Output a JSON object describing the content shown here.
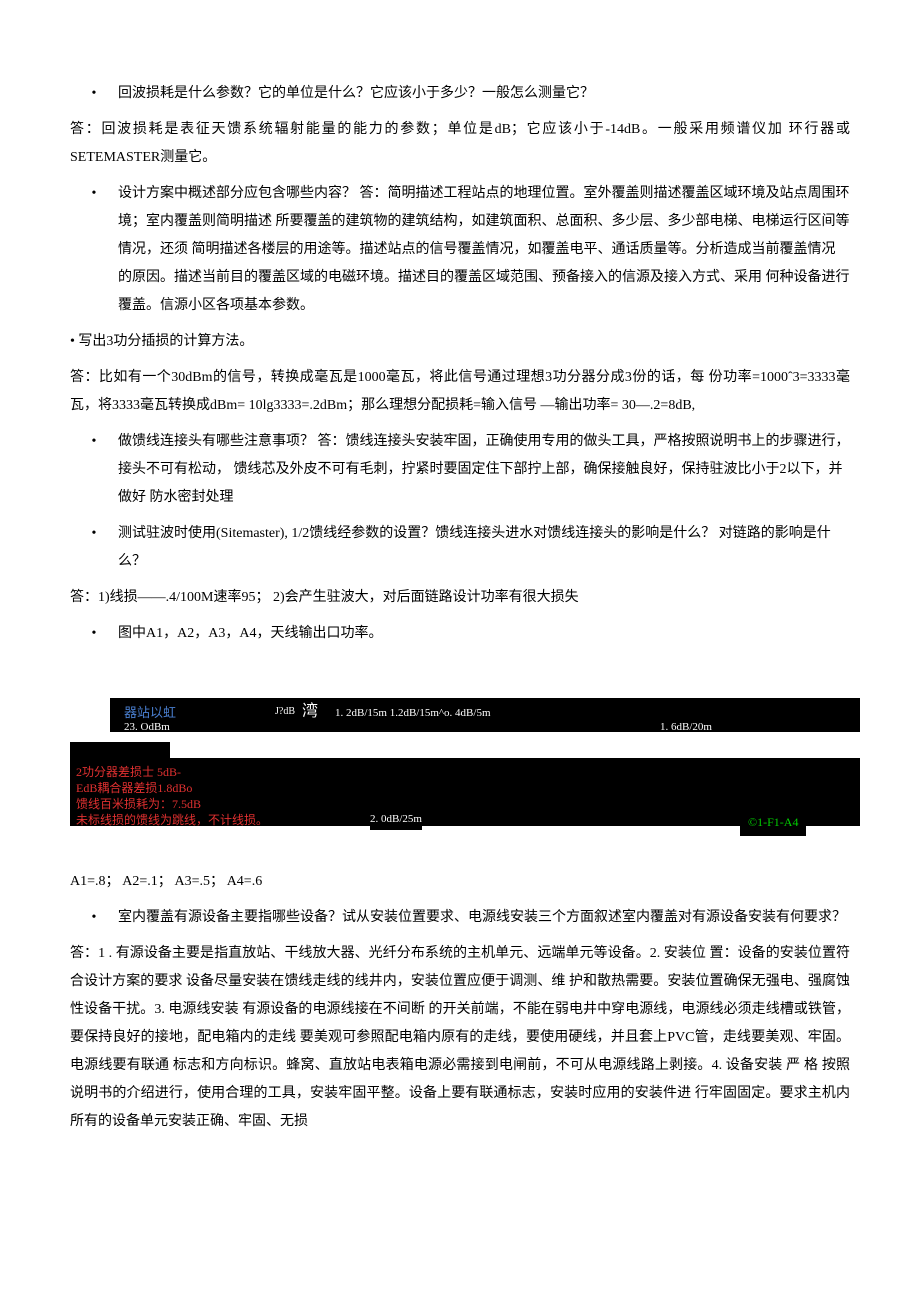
{
  "q1": {
    "question": "回波损耗是什么参数？它的单位是什么？它应该小于多少？一般怎么测量它？",
    "answer": "答：回波损耗是表征天馈系统辐射能量的能力的参数；单位是dB；它应该小于-14dB。一般采用频谱仪加 环行器或SETEMASTER测量它。"
  },
  "q2": {
    "question": "设计方案中概述部分应包含哪些内容？   答：简明描述工程站点的地理位置。室外覆盖则描述覆盖区域环境及站点周围环境；室内覆盖则简明描述  所要覆盖的建筑物的建筑结构，如建筑面积、总面积、多少层、多少部电梯、电梯运行区间等情况，还须 简明描述各楼层的用途等。描述站点的信号覆盖情况，如覆盖电平、通话质量等。分析造成当前覆盖情况 的原因。描述当前目的覆盖区域的电磁环境。描述目的覆盖区域范围、预备接入的信源及接入方式、采用 何种设备进行覆盖。信源小区各项基本参数。"
  },
  "q3": {
    "text": "• 写出3功分插损的计算方法。",
    "answer": "答：比如有一个30dBm的信号，转换成毫瓦是1000毫瓦，将此信号通过理想3功分器分成3份的话，每         份功率=1000ˆ3=3333毫瓦，将3333毫瓦转换成dBm=    10lg3333=.2dBm；那么理想分配损耗=输入信号   —输出功率=   30—.2=8dB,"
  },
  "q4": {
    "question": "做馈线连接头有哪些注意事项？   答：馈线连接头安装牢固，正确使用专用的做头工具，严格按照说明书上的步骤进行，接头不可有松动，   馈线芯及外皮不可有毛刺，拧紧时要固定住下部拧上部，确保接触良好，保持驻波比小于2以下，并做好 防水密封处理"
  },
  "q5": {
    "question": "测试驻波时使用(Sitemaster), 1/2馈线经参数的设置？馈线连接头进水对馈线连接头的影响是什么？  对链路的影响是什么？",
    "answer": "答：1)线损——.4/100M速率95；  2)会产生驻波大，对后面链路设计功率有很大损失"
  },
  "q6": {
    "question": "图中A1，A2，A3，A4，天线输出口功率。"
  },
  "diagram": {
    "top1": "器站以虹",
    "top1b": "23. OdBm",
    "jdb": "J?dB",
    "wan": "湾",
    "seq1": "1. 2dB/15m 1.2dB/15m^o. 4dB/5m",
    "right1": "1. 6dB/20m",
    "red1": "2功分器差损士  5dB-",
    "red2": "EdB耦合器差损1.8dBo",
    "red3": "馈线百米损耗为：7.5dB",
    "red4": "未标线损的馈线为跳线，不计线损。",
    "mid1": "2. 0dB/25m",
    "green": "©1-F1-A4"
  },
  "result": "A1=.8；  A2=.1；  A3=.5；  A4=.6",
  "q7": {
    "question": "室内覆盖有源设备主要指哪些设备？试从安装位置要求、电源线安装三个方面叙述室内覆盖对有源设备安装有何要求？",
    "answer": "答：1 . 有源设备主要是指直放站、干线放大器、光纤分布系统的主机单元、远端单元等设备。2. 安装位  置：设备的安装位置符合设计方案的要求  设备尽量安装在馈线走线的线井内，安装位置应便于调测、维  护和散热需要。安装位置确保无强电、强腐蚀性设备干扰。3. 电源线安装  有源设备的电源线接在不间断  的开关前端，不能在弱电井中穿电源线，电源线必须走线槽或铁管，要保持良好的接地，配电箱内的走线  要美观可参照配电箱内原有的走线，要使用硬线，并且套上PVC管，走线要美观、牢固。电源线要有联通  标志和方向标识。蜂窝、直放站电表箱电源必需接到电闸前，不可从电源线路上剥接。4. 设备安装  严 格  按照说明书的介绍进行，使用合理的工具，安装牢固平整。设备上要有联通标志，安装时应用的安装件进  行牢固固定。要求主机内所有的设备单元安装正确、牢固、无损"
  }
}
